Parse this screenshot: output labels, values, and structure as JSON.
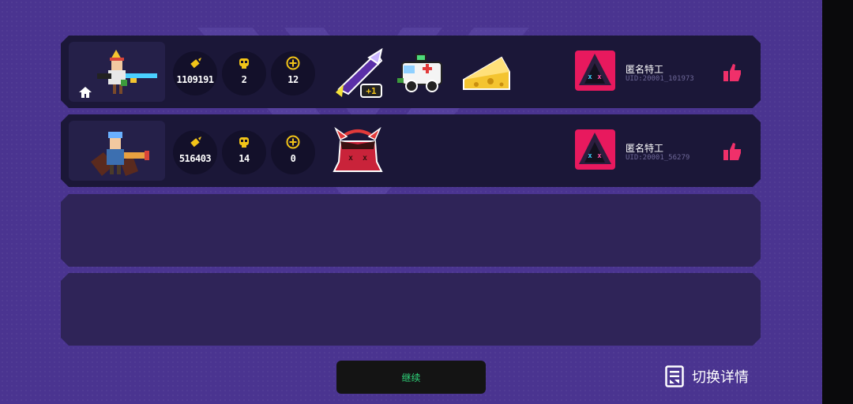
{
  "colors": {
    "background": "#4a3490",
    "panel": "#1b1738",
    "empty_panel": "#2f2458",
    "rank1": "#e63a3a",
    "rank2": "#33a6ff",
    "coin": "#f2c418",
    "like": "#f0306a",
    "continue_text": "#2fd67b"
  },
  "players": [
    {
      "rank": "1",
      "is_host": true,
      "stats": {
        "ammo": "1109191",
        "kills": "2",
        "heal": "12"
      },
      "items": [
        "purple-shark-rocket-item",
        "ambulance-item",
        "cheese-item"
      ],
      "name": "匿名特工",
      "uid": "UID:20001_101973"
    },
    {
      "rank": "2",
      "is_host": false,
      "stats": {
        "ammo": "516403",
        "kills": "14",
        "heal": "0"
      },
      "items": [
        "red-demon-head-item"
      ],
      "name": "匿名特工",
      "uid": "UID:20001_56279"
    }
  ],
  "empty_slots": 2,
  "footer": {
    "continue_label": "继续",
    "switch_label": "切换详情"
  }
}
